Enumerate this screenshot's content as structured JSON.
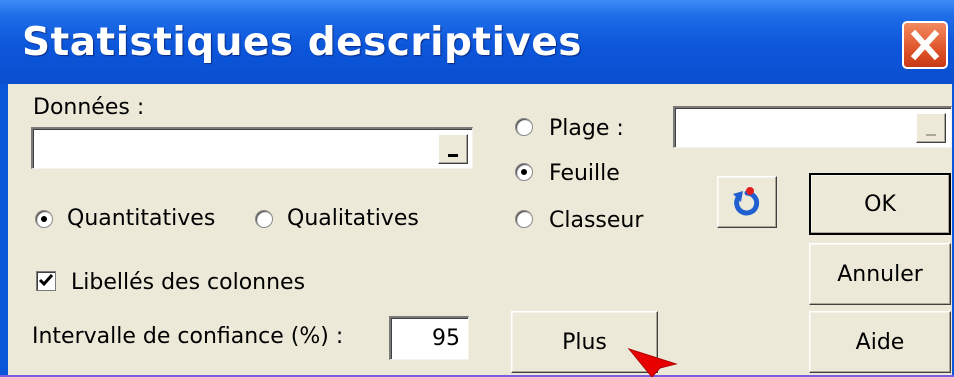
{
  "dialog": {
    "title": "Statistiques descriptives",
    "data_label": "Données :",
    "data_value": "",
    "quantitative_label": "Quantitatives",
    "quantitative_selected": true,
    "qualitative_label": "Qualitatives",
    "qualitative_selected": false,
    "column_labels_label": "Libellés des colonnes",
    "column_labels_checked": true,
    "confidence_label": "Intervalle de confiance (%) :",
    "confidence_value": "95",
    "more_label": "Plus",
    "output": {
      "range_label": "Plage :",
      "range_value": "",
      "sheet_label": "Feuille",
      "workbook_label": "Classeur",
      "selected": "Feuille"
    },
    "ok_label": "OK",
    "cancel_label": "Annuler",
    "help_label": "Aide"
  },
  "icons": {
    "close": "close-icon",
    "refresh": "refresh-icon",
    "cursor": "mouse-pointer-icon"
  },
  "colors": {
    "title_bar": "#0a56d8",
    "dialog_background": "#ece9d8",
    "close_button": "#e0542a",
    "refresh_icon": "#1f5fd0",
    "pointer": "#e80000"
  }
}
